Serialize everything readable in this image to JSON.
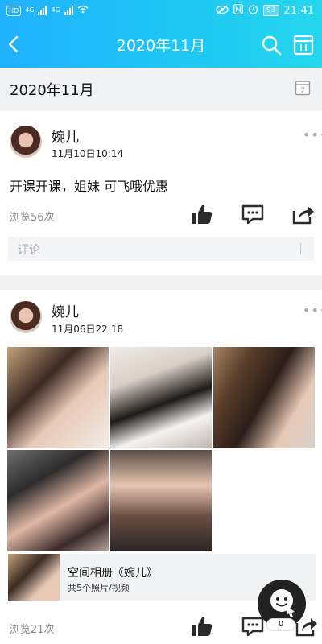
{
  "status_bar": {
    "left": [
      "HD",
      "4G",
      "4G"
    ],
    "battery": "93",
    "time": "21:41"
  },
  "header": {
    "title": "2020年11月",
    "icons": [
      "back-arrow-icon",
      "search-icon",
      "calendar-icon"
    ]
  },
  "month_bar": {
    "label": "2020年11月",
    "calendar_day": "7"
  },
  "posts": [
    {
      "name": "婉儿",
      "date": "11月10日10:14",
      "text": "开课开课，姐妹 可飞哦优惠",
      "views": "浏览56次",
      "comment_placeholder": "评论"
    },
    {
      "name": "婉儿",
      "date": "11月06日22:18",
      "photos": 5,
      "album": {
        "title": "空间相册《婉儿》",
        "count": "共5个照片/视频"
      },
      "views": "浏览21次",
      "float_badge": "0"
    }
  ],
  "colors": {
    "header_start": "#1fb1ff",
    "header_end": "#24d6ee",
    "divider": "#f1f2f4"
  }
}
